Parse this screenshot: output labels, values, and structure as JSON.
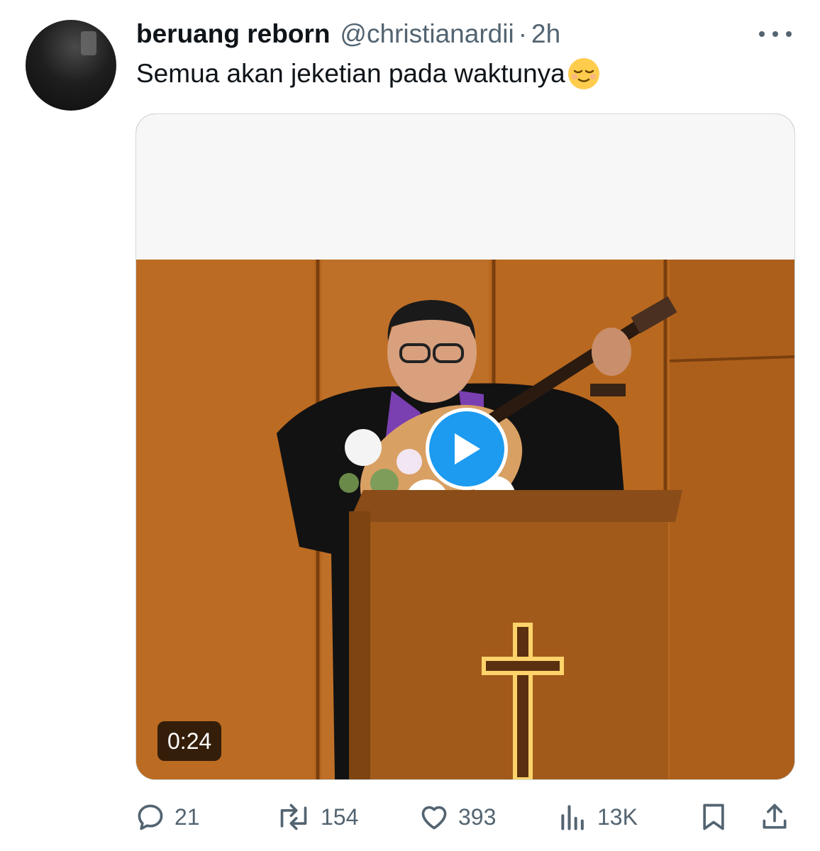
{
  "tweet": {
    "display_name": "beruang reborn",
    "handle": "@christianardii",
    "separator": "·",
    "time": "2h",
    "text": "Semua akan jeketian pada waktunya",
    "emoji": "relieved-face-emoji"
  },
  "media": {
    "duration": "0:24",
    "play_icon": "play-icon"
  },
  "actions": {
    "replies": "21",
    "reposts": "154",
    "likes": "393",
    "views": "13K"
  },
  "colors": {
    "accent": "#1d9bf0",
    "secondary_text": "#536471",
    "primary_text": "#0f1419"
  }
}
